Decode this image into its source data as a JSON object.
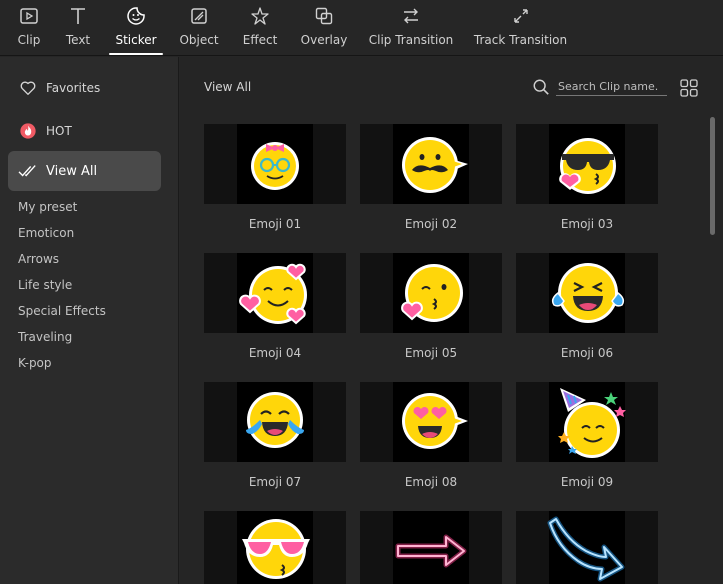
{
  "tabs": [
    {
      "label": "Clip",
      "icon": "clip-icon"
    },
    {
      "label": "Text",
      "icon": "text-icon"
    },
    {
      "label": "Sticker",
      "icon": "sticker-icon",
      "active": true
    },
    {
      "label": "Object",
      "icon": "object-icon"
    },
    {
      "label": "Effect",
      "icon": "effect-icon"
    },
    {
      "label": "Overlay",
      "icon": "overlay-icon"
    },
    {
      "label": "Clip Transition",
      "icon": "clip-transition-icon"
    },
    {
      "label": "Track Transition",
      "icon": "track-transition-icon"
    }
  ],
  "sidebar": {
    "main": [
      {
        "label": "Favorites",
        "icon": "heart-icon"
      },
      {
        "label": "HOT",
        "icon": "hot-icon"
      },
      {
        "label": "View All",
        "icon": "check-icon",
        "active": true
      }
    ],
    "categories": [
      "My preset",
      "Emoticon",
      "Arrows",
      "Life style",
      "Special Effects",
      "Traveling",
      "K-pop"
    ]
  },
  "main": {
    "title": "View All",
    "search_placeholder": "Search Clip name.",
    "items": [
      {
        "label": "Emoji 01"
      },
      {
        "label": "Emoji 02"
      },
      {
        "label": "Emoji 03"
      },
      {
        "label": "Emoji 04"
      },
      {
        "label": "Emoji 05"
      },
      {
        "label": "Emoji 06"
      },
      {
        "label": "Emoji 07"
      },
      {
        "label": "Emoji 08"
      },
      {
        "label": "Emoji 09"
      },
      {
        "label": ""
      },
      {
        "label": ""
      },
      {
        "label": ""
      }
    ]
  },
  "colors": {
    "background": "#262626",
    "active_item": "#4a4a4a",
    "emoji_yellow": "#ffd60a",
    "neon_pink": "#ff3d8b",
    "neon_blue": "#2aa6ff"
  }
}
